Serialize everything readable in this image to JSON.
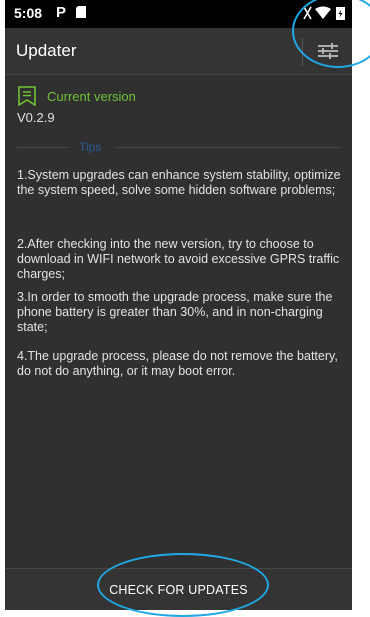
{
  "status_bar": {
    "time": "5:08",
    "notification_icon": "P"
  },
  "app": {
    "title": "Updater"
  },
  "icons": {
    "settings": "sliders-icon",
    "current_version": "bookmark-message-icon"
  },
  "current": {
    "label": "Current version",
    "version": "V0.2.9"
  },
  "tips": {
    "heading": "Tips",
    "items": [
      "1.System upgrades can enhance system stability, optimize the system speed, solve some hidden software problems;",
      "2.After checking into the new version, try to choose to download in WIFI network to avoid excessive GPRS traffic charges;",
      "3.In order to smooth the upgrade process, make sure the phone battery is greater than 30%, and in non-charging state;",
      "4.The upgrade process, please do not remove the battery, do not do anything, or it may boot error."
    ]
  },
  "footer": {
    "button_label": "CHECK FOR UPDATES"
  },
  "colors": {
    "accent_green": "#70c237",
    "tips_blue": "#2c5a94",
    "highlight": "#20a8e6",
    "background": "#303030"
  }
}
